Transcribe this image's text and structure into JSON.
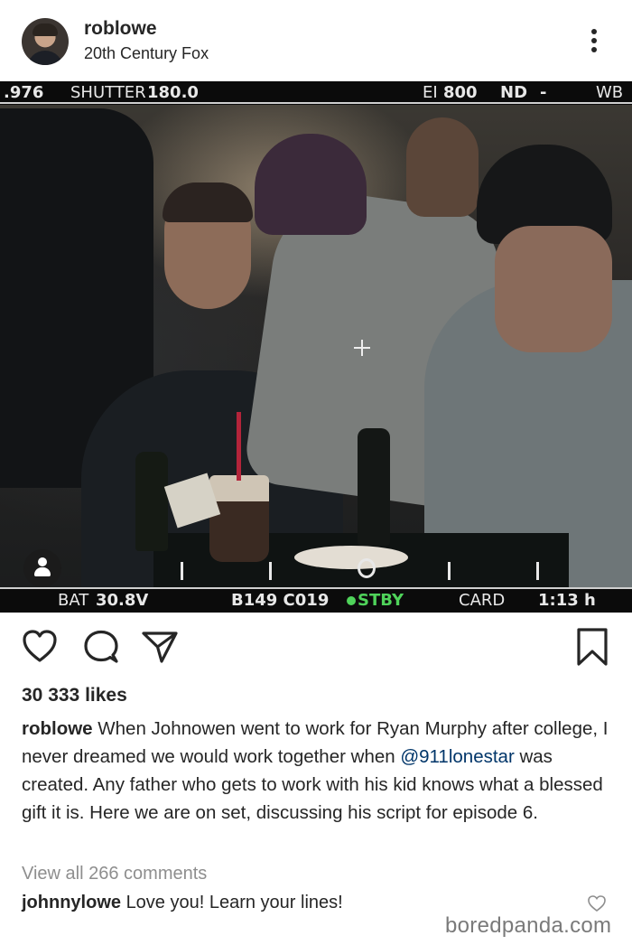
{
  "header": {
    "username": "roblowe",
    "location": "20th Century Fox"
  },
  "photo": {
    "hud_top": {
      "aperture": ".976",
      "shutter_label": "SHUTTER",
      "shutter_value": "180.0",
      "ei_label": "EI",
      "ei_value": "800",
      "nd_label": "ND",
      "nd_value": "-",
      "wb_label": "WB"
    },
    "hud_bottom": {
      "bat_label": "BAT",
      "bat_value": "30.8V",
      "clip": "B149 C019",
      "status": "STBY",
      "card_label": "CARD",
      "time_remaining": "1:13 h"
    }
  },
  "post": {
    "likes": "30 333 likes",
    "caption_user": "roblowe",
    "caption_part1": "When Johnowen went to work for Ryan Murphy after college, I never dreamed we would work together when ",
    "caption_mention": "@911lonestar",
    "caption_part2": " was created. Any father who gets to work with his kid knows what a blessed gift it is. Here we are on set, discussing his script for episode 6.",
    "view_all": "View all 266 comments",
    "comment_user": "johnnylowe",
    "comment_text": "Love you! Learn your lines!"
  },
  "watermark": "boredpanda.com"
}
